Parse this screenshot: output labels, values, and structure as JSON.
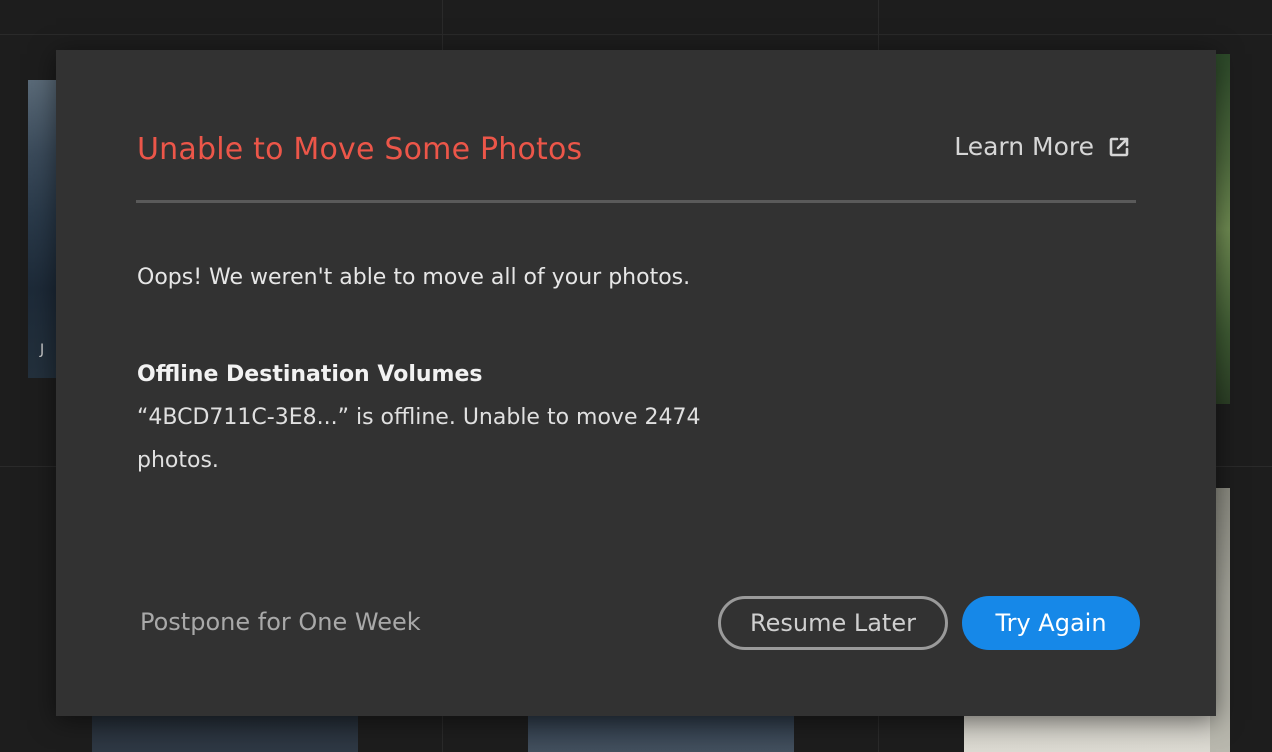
{
  "dialog": {
    "title": "Unable to Move Some Photos",
    "learn_more_label": "Learn More",
    "message": "Oops! We weren't able to move all of your photos.",
    "section": {
      "heading": "Offline Destination Volumes",
      "body": "“4BCD711C-3E8...” is offline. Unable to move 2474 photos."
    },
    "actions": {
      "postpone_label": "Postpone for One Week",
      "resume_label": "Resume Later",
      "try_again_label": "Try Again"
    }
  },
  "background": {
    "thumbnail_label": "J"
  },
  "colors": {
    "title": "#ec5649",
    "primary_button": "#1688e8",
    "dialog_background": "#323232"
  },
  "icons": {
    "learn_more": "external-link-icon"
  }
}
